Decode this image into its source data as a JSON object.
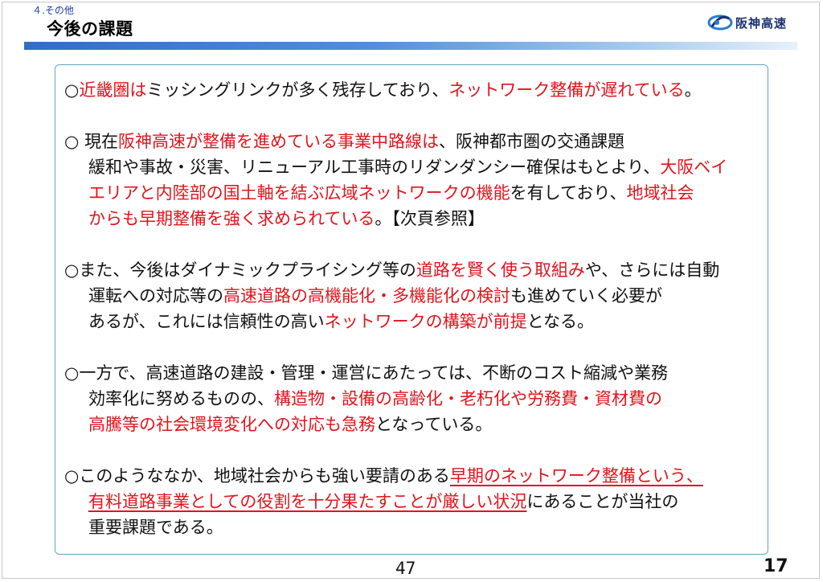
{
  "header": {
    "section": "４.その他",
    "title": "今後の課題",
    "logo_text": "阪神高速",
    "colors": {
      "accent_bar": "#2f6fc4",
      "highlight": "#e0141c",
      "box_border": "#62a6c0"
    }
  },
  "paragraphs": [
    {
      "lines": [
        [
          {
            "t": "○",
            "c": 0
          },
          {
            "t": "近畿圏は",
            "c": 1
          },
          {
            "t": "ミッシングリンクが多く残存しており、",
            "c": 0
          },
          {
            "t": "ネットワーク整備が遅れている",
            "c": 1
          },
          {
            "t": "。",
            "c": 0
          }
        ]
      ]
    },
    {
      "lines": [
        [
          {
            "t": "○ 現在",
            "c": 0
          },
          {
            "t": "阪神高速が整備を進めている事業中路線は",
            "c": 1
          },
          {
            "t": "、阪神都市圏の交通課題",
            "c": 0
          }
        ],
        [
          {
            "t": "緩和や事故・災害、リニューアル工事時のリダンダンシー確保はもとより、",
            "c": 0
          },
          {
            "t": "大阪ベイ",
            "c": 1
          }
        ],
        [
          {
            "t": "エリアと内陸部の国土軸を結ぶ広域ネットワークの機能",
            "c": 1
          },
          {
            "t": "を有しており、",
            "c": 0
          },
          {
            "t": "地域社会",
            "c": 1
          }
        ],
        [
          {
            "t": "からも早期整備を強く求められている",
            "c": 1
          },
          {
            "t": "。【次頁参照】",
            "c": 0
          }
        ]
      ]
    },
    {
      "lines": [
        [
          {
            "t": "○また、今後はダイナミックプライシング等の",
            "c": 0
          },
          {
            "t": "道路を賢く使う取組み",
            "c": 1
          },
          {
            "t": "や、さらには自動",
            "c": 0
          }
        ],
        [
          {
            "t": "運転への対応等の",
            "c": 0
          },
          {
            "t": "高速道路の高機能化・多機能化の検討",
            "c": 1
          },
          {
            "t": "も進めていく必要が",
            "c": 0
          }
        ],
        [
          {
            "t": "あるが、これには信頼性の高い",
            "c": 0
          },
          {
            "t": "ネットワークの構築が前提",
            "c": 1
          },
          {
            "t": "となる。",
            "c": 0
          }
        ]
      ]
    },
    {
      "lines": [
        [
          {
            "t": "○一方で、高速道路の建設・管理・運営にあたっては、不断のコスト縮減や業務",
            "c": 0
          }
        ],
        [
          {
            "t": "効率化に努めるものの、",
            "c": 0
          },
          {
            "t": "構造物・設備の高齢化・老朽化や労務費・資材費の",
            "c": 1
          }
        ],
        [
          {
            "t": "高騰等の社会環境変化への対応も急務",
            "c": 1
          },
          {
            "t": "となっている。",
            "c": 0
          }
        ]
      ]
    },
    {
      "lines": [
        [
          {
            "t": "○このようななか、地域社会からも強い要請のある",
            "c": 0
          },
          {
            "t": "早期のネットワーク整備という、",
            "c": 2
          }
        ],
        [
          {
            "t": "有料道路事業としての役割を十分果たすことが厳しい状況",
            "c": 2
          },
          {
            "t": "にあることが当社の",
            "c": 0
          }
        ],
        [
          {
            "t": "重要課題である。",
            "c": 0
          }
        ]
      ]
    }
  ],
  "footer": {
    "page_center": "47",
    "page_right": "17"
  }
}
